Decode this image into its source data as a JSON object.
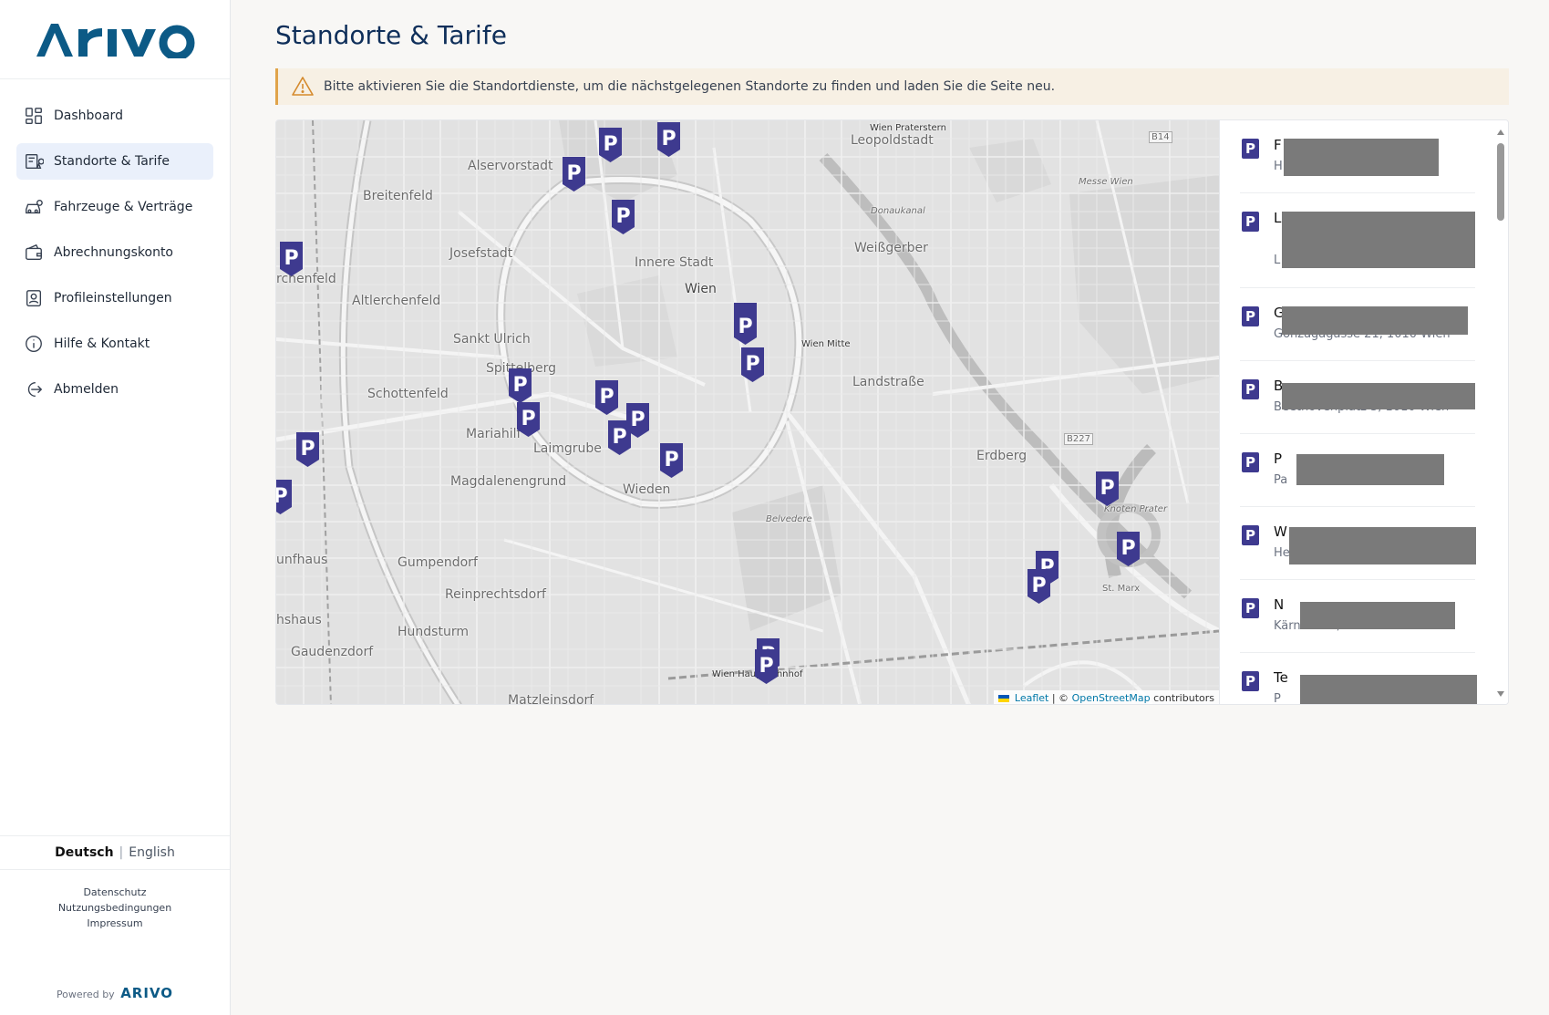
{
  "brand": {
    "logo_text": "ARIVO",
    "color": "#0c5a86"
  },
  "sidebar": {
    "items": [
      {
        "label": "Dashboard",
        "icon": "dashboard-icon",
        "active": false
      },
      {
        "label": "Standorte & Tarife",
        "icon": "locations-icon",
        "active": true
      },
      {
        "label": "Fahrzeuge & Verträge",
        "icon": "car-icon",
        "active": false
      },
      {
        "label": "Abrechnungskonto",
        "icon": "wallet-icon",
        "active": false
      },
      {
        "label": "Profileinstellungen",
        "icon": "profile-icon",
        "active": false
      },
      {
        "label": "Hilfe & Kontakt",
        "icon": "info-icon",
        "active": false
      },
      {
        "label": "Abmelden",
        "icon": "logout-icon",
        "active": false
      }
    ],
    "language": {
      "de": "Deutsch",
      "separator": "|",
      "en": "English"
    },
    "footer_links": {
      "privacy": "Datenschutz",
      "terms": "Nutzungsbedingungen",
      "imprint": "Impressum"
    },
    "powered_by": "Powered by",
    "powered_logo": "ARIVO"
  },
  "main": {
    "title": "Standorte & Tarife",
    "alert": "Bitte aktivieren Sie die Standortdienste, um die nächstgelegenen Standorte zu finden und laden Sie die Seite neu."
  },
  "map": {
    "labels": {
      "alservorstadt": "Alservorstadt",
      "breitenfeld": "Breitenfeld",
      "josefstadt": "Josefstadt",
      "innere_stadt": "Innere Stadt",
      "wien": "Wien",
      "leopoldstadt": "Leopoldstadt",
      "wien_praterstern": "Wien Praterstern",
      "weissgerber": "Weißgerber",
      "altlerchenfeld": "Altlerchenfeld",
      "lerchenfeld": "rchenfeld",
      "sankt_ulrich": "Sankt Ulrich",
      "spittelberg": "Spittelberg",
      "schottenfeld": "Schottenfeld",
      "mariahilf": "Mariahilf",
      "laimgrube": "Laimgrube",
      "magdalenengrund": "Magdalenengrund",
      "wieden": "Wieden",
      "landstrasse": "Landstraße",
      "wien_mitte": "Wien Mitte",
      "erdberg": "Erdberg",
      "gumpendorf": "Gumpendorf",
      "reinprechtsdorf": "Reinprechtsdorf",
      "hundsturm": "Hundsturm",
      "gaudenzdorf": "Gaudenzdorf",
      "matzleinsdorf": "Matzleinsdorf",
      "wien_hauptbahnhof": "Wien Hauptbahnhof",
      "belvedere": "Belvedere",
      "messe_wien": "Messe Wien",
      "knoten_prater": "Knoten Prater",
      "st_marx": "St. Marx",
      "fuenfhaus": "unfhaus",
      "sechshaus": "hshaus",
      "b14": "B14",
      "b227": "B227",
      "donaukanal": "Donaukanal"
    },
    "attribution": {
      "leaflet": "Leaflet",
      "sep": "| ©",
      "osm": "OpenStreetMap",
      "suffix": "contributors"
    }
  },
  "locations": {
    "items": [
      {
        "badge": "P",
        "title": "F",
        "subtitle": "H"
      },
      {
        "badge": "P",
        "title": "L",
        "subtitle": "L"
      },
      {
        "badge": "P",
        "title": "G",
        "subtitle": "Gonzagagasse 21, 1010 Wien"
      },
      {
        "badge": "P",
        "title": "B",
        "subtitle": "Beethovenplatz 3, 1010 Wien"
      },
      {
        "badge": "P",
        "title": "P",
        "subtitle": "Pa"
      },
      {
        "badge": "P",
        "title": "W",
        "subtitle": "He"
      },
      {
        "badge": "P",
        "title": "N",
        "subtitle": "Kärntner 4, 1010 Wien"
      },
      {
        "badge": "P",
        "title": "Te",
        "subtitle": "P"
      }
    ]
  }
}
